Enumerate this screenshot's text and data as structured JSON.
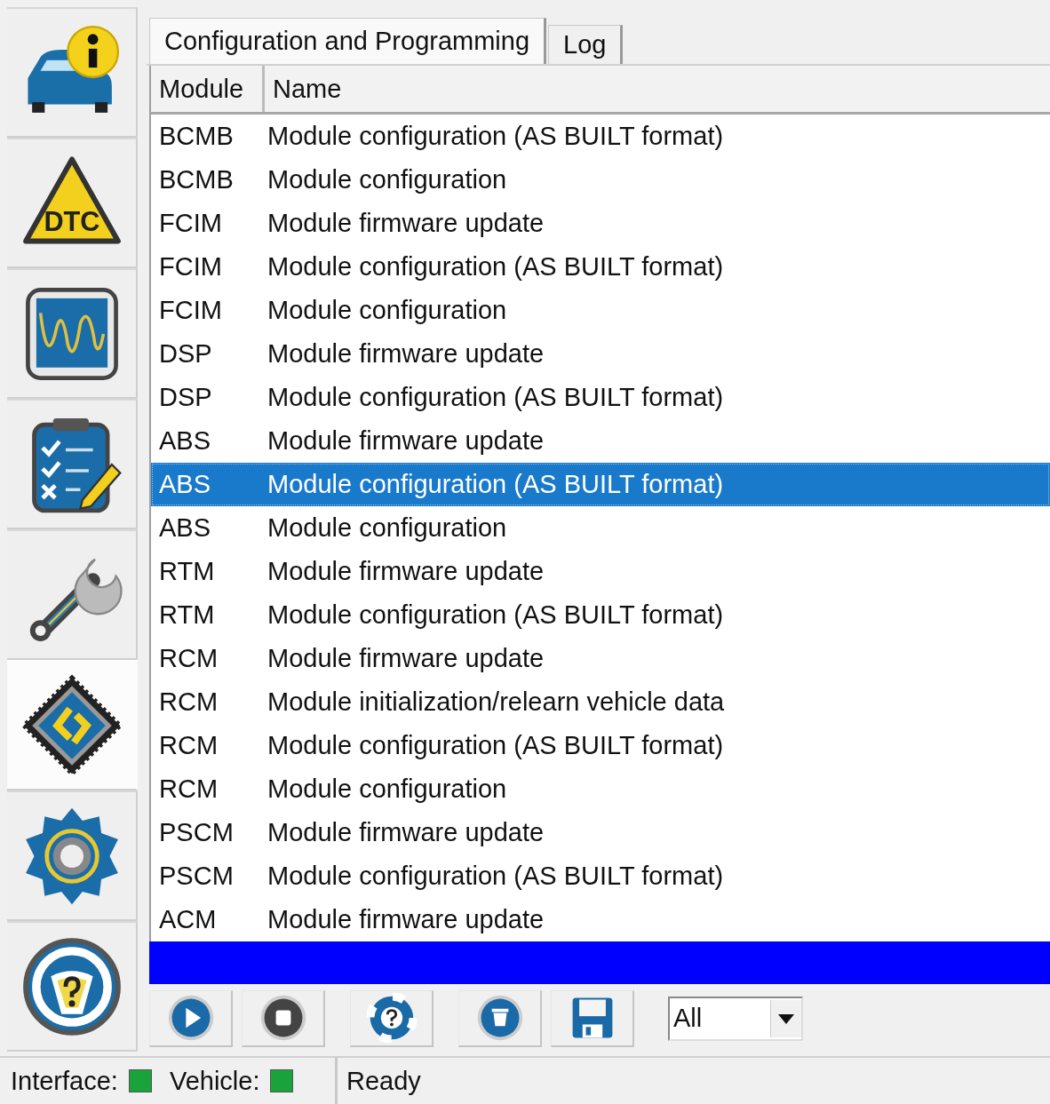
{
  "sidebar": {
    "items": [
      {
        "kind": "vehicle-info",
        "selected": false
      },
      {
        "kind": "dtc",
        "selected": false,
        "text": "DTC"
      },
      {
        "kind": "oscilloscope",
        "selected": false
      },
      {
        "kind": "checklist",
        "selected": false
      },
      {
        "kind": "service",
        "selected": false
      },
      {
        "kind": "programming",
        "selected": true
      },
      {
        "kind": "settings",
        "selected": false
      },
      {
        "kind": "help",
        "selected": false
      }
    ]
  },
  "tabs": [
    {
      "label": "Configuration and Programming",
      "selected": true
    },
    {
      "label": "Log",
      "selected": false
    }
  ],
  "table": {
    "columns": [
      "Module",
      "Name"
    ],
    "rows": [
      {
        "module": "BCMB",
        "name": "Module configuration (AS BUILT format)",
        "selected": false
      },
      {
        "module": "BCMB",
        "name": "Module configuration",
        "selected": false
      },
      {
        "module": "FCIM",
        "name": "Module firmware update",
        "selected": false
      },
      {
        "module": "FCIM",
        "name": "Module configuration (AS BUILT format)",
        "selected": false
      },
      {
        "module": "FCIM",
        "name": "Module configuration",
        "selected": false
      },
      {
        "module": "DSP",
        "name": "Module firmware update",
        "selected": false
      },
      {
        "module": "DSP",
        "name": "Module configuration (AS BUILT format)",
        "selected": false
      },
      {
        "module": "ABS",
        "name": "Module firmware update",
        "selected": false
      },
      {
        "module": "ABS",
        "name": "Module configuration (AS BUILT format)",
        "selected": true
      },
      {
        "module": "ABS",
        "name": "Module configuration",
        "selected": false
      },
      {
        "module": "RTM",
        "name": "Module firmware update",
        "selected": false
      },
      {
        "module": "RTM",
        "name": "Module configuration (AS BUILT format)",
        "selected": false
      },
      {
        "module": "RCM",
        "name": "Module firmware update",
        "selected": false
      },
      {
        "module": "RCM",
        "name": "Module initialization/relearn vehicle data",
        "selected": false
      },
      {
        "module": "RCM",
        "name": "Module configuration (AS BUILT format)",
        "selected": false
      },
      {
        "module": "RCM",
        "name": "Module configuration",
        "selected": false
      },
      {
        "module": "PSCM",
        "name": "Module firmware update",
        "selected": false
      },
      {
        "module": "PSCM",
        "name": "Module configuration (AS BUILT format)",
        "selected": false
      },
      {
        "module": "ACM",
        "name": "Module firmware update",
        "selected": false
      }
    ]
  },
  "progress": {
    "level": 1
  },
  "toolbar": {
    "buttons": [
      {
        "kind": "play"
      },
      {
        "kind": "stop"
      },
      {
        "kind": "help"
      },
      {
        "kind": "delete"
      },
      {
        "kind": "save"
      }
    ],
    "filter": {
      "value": "All"
    }
  },
  "status_bar": {
    "indicators": [
      {
        "label": "Interface:",
        "color": "#1aa33a"
      },
      {
        "label": "Vehicle:",
        "color": "#1aa33a"
      }
    ],
    "message": "Ready"
  }
}
